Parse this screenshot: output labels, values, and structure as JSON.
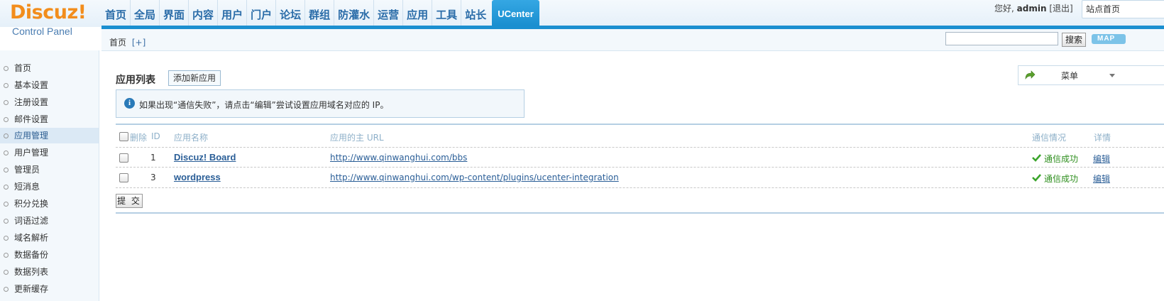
{
  "logo": {
    "main": "Discuz!",
    "sub": "Control Panel"
  },
  "nav": [
    "首页",
    "全局",
    "界面",
    "内容",
    "用户",
    "门户",
    "论坛",
    "群组",
    "防灌水",
    "运营",
    "应用",
    "工具",
    "站长",
    "UCenter"
  ],
  "nav_active_index": 13,
  "user": {
    "greeting": "您好,",
    "name": "admin",
    "logout": "[退出]",
    "site_home": "站点首页"
  },
  "subbar": {
    "breadcrumb": "首页",
    "add": "[+]",
    "search_button": "搜索",
    "map_button": "MAP"
  },
  "sidebar": {
    "items": [
      "首页",
      "基本设置",
      "注册设置",
      "邮件设置",
      "应用管理",
      "用户管理",
      "管理员",
      "短消息",
      "积分兑换",
      "词语过滤",
      "域名解析",
      "数据备份",
      "数据列表",
      "更新缓存"
    ],
    "active_index": 4
  },
  "main": {
    "title": "应用列表",
    "add_app_button": "添加新应用",
    "menu_label": "菜单",
    "notice": "如果出现“通信失败”，请点击“编辑”尝试设置应用域名对应的 IP。",
    "info_icon": "i"
  },
  "table": {
    "headers": {
      "delete": "删除",
      "id": "ID",
      "name": "应用名称",
      "url": "应用的主 URL",
      "status": "通信情况",
      "detail": "详情"
    },
    "rows": [
      {
        "id": "1",
        "name": "Discuz! Board",
        "url": "http://www.qinwanghui.com/bbs",
        "status": "通信成功",
        "action": "编辑"
      },
      {
        "id": "3",
        "name": "wordpress",
        "url": "http://www.qinwanghui.com/wp-content/plugins/ucenter-integration",
        "status": "通信成功",
        "action": "编辑"
      }
    ],
    "submit_button": "提 交"
  },
  "colors": {
    "accent": "#1a8fd0",
    "logo": "#f28d1c",
    "link": "#2a5e97",
    "success": "#2f8f1f"
  }
}
